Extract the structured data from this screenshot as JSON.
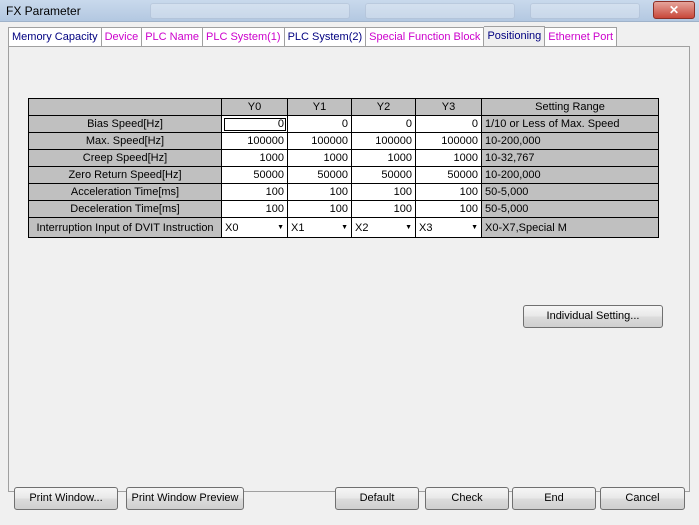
{
  "window": {
    "title": "FX Parameter",
    "close_glyph": "✕"
  },
  "tabs": [
    {
      "label": "Memory Capacity",
      "color": "#000080"
    },
    {
      "label": "Device",
      "color": "#cc00cc"
    },
    {
      "label": "PLC Name",
      "color": "#cc00cc"
    },
    {
      "label": "PLC System(1)",
      "color": "#cc00cc"
    },
    {
      "label": "PLC System(2)",
      "color": "#000080"
    },
    {
      "label": "Special Function Block",
      "color": "#cc00cc"
    },
    {
      "label": "Positioning",
      "color": "#000080"
    },
    {
      "label": "Ethernet Port",
      "color": "#cc00cc"
    }
  ],
  "table": {
    "columns": [
      "Y0",
      "Y1",
      "Y2",
      "Y3"
    ],
    "range_header": "Setting Range",
    "rows": [
      {
        "label": "Bias Speed[Hz]",
        "values": [
          "0",
          "0",
          "0",
          "0"
        ],
        "range": "1/10 or Less of Max. Speed"
      },
      {
        "label": "Max. Speed[Hz]",
        "values": [
          "100000",
          "100000",
          "100000",
          "100000"
        ],
        "range": "10-200,000"
      },
      {
        "label": "Creep Speed[Hz]",
        "values": [
          "1000",
          "1000",
          "1000",
          "1000"
        ],
        "range": "10-32,767"
      },
      {
        "label": "Zero Return Speed[Hz]",
        "values": [
          "50000",
          "50000",
          "50000",
          "50000"
        ],
        "range": "10-200,000"
      },
      {
        "label": "Acceleration Time[ms]",
        "values": [
          "100",
          "100",
          "100",
          "100"
        ],
        "range": "50-5,000"
      },
      {
        "label": "Deceleration Time[ms]",
        "values": [
          "100",
          "100",
          "100",
          "100"
        ],
        "range": "50-5,000"
      }
    ],
    "interrupt_row": {
      "label": "Interruption Input of DVIT Instruction",
      "values": [
        "X0",
        "X1",
        "X2",
        "X3"
      ],
      "range": "X0-X7,Special M"
    }
  },
  "buttons": {
    "individual_setting": "Individual Setting...",
    "print_window": "Print Window...",
    "print_window_preview": "Print Window Preview",
    "default": "Default",
    "check": "Check",
    "end": "End",
    "cancel": "Cancel"
  }
}
